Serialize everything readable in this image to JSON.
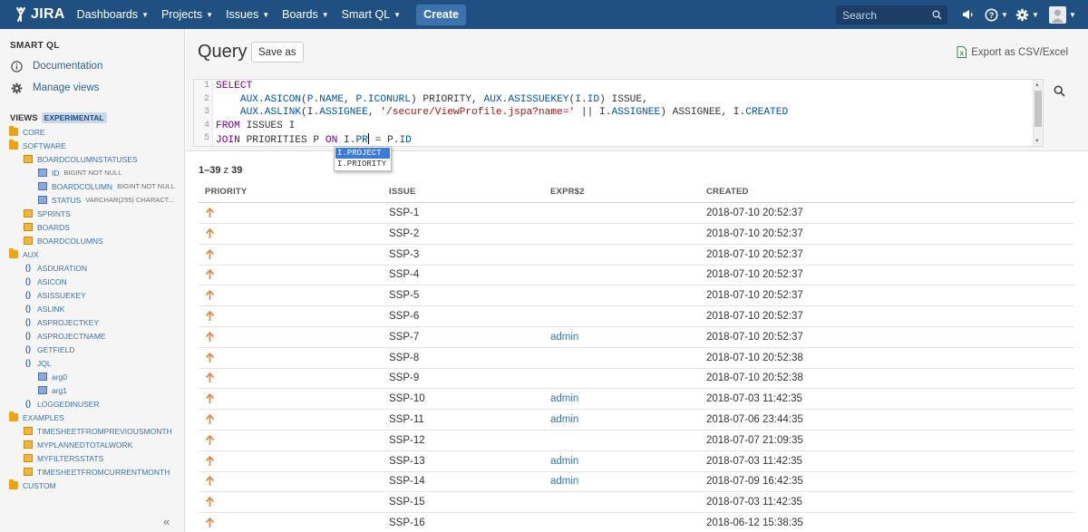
{
  "topnav": {
    "logo_text": "JIRA",
    "menus": [
      {
        "label": "Dashboards"
      },
      {
        "label": "Projects"
      },
      {
        "label": "Issues"
      },
      {
        "label": "Boards"
      },
      {
        "label": "Smart QL"
      }
    ],
    "create_label": "Create",
    "search_placeholder": "Search"
  },
  "sidebar": {
    "title": "SMART QL",
    "links": [
      {
        "label": "Documentation",
        "icon": "info-icon"
      },
      {
        "label": "Manage views",
        "icon": "gear-icon"
      }
    ],
    "views_title": "VIEWS",
    "views_badge": "EXPERIMENTAL",
    "tree": [
      {
        "label": "CORE",
        "type": "folder",
        "level": 0
      },
      {
        "label": "SOFTWARE",
        "type": "folder",
        "level": 0
      },
      {
        "label": "BOARDCOLUMNSTATUSES",
        "type": "table",
        "level": 1
      },
      {
        "label": "ID",
        "type": "column",
        "level": 2,
        "coltype": "BIGINT NOT NULL"
      },
      {
        "label": "BOARDCOLUMN",
        "type": "column",
        "level": 2,
        "coltype": "BIGINT NOT NULL"
      },
      {
        "label": "STATUS",
        "type": "column",
        "level": 2,
        "coltype": "VARCHAR(255) CHARACT..."
      },
      {
        "label": "SPRINTS",
        "type": "table",
        "level": 1
      },
      {
        "label": "BOARDS",
        "type": "table",
        "level": 1
      },
      {
        "label": "BOARDCOLUMNS",
        "type": "table",
        "level": 1
      },
      {
        "label": "AUX",
        "type": "folder",
        "level": 0
      },
      {
        "label": "ASDURATION",
        "type": "function",
        "level": 1
      },
      {
        "label": "ASICON",
        "type": "function",
        "level": 1
      },
      {
        "label": "ASISSUEKEY",
        "type": "function",
        "level": 1
      },
      {
        "label": "ASLINK",
        "type": "function",
        "level": 1
      },
      {
        "label": "ASPROJECTKEY",
        "type": "function",
        "level": 1
      },
      {
        "label": "ASPROJECTNAME",
        "type": "function",
        "level": 1
      },
      {
        "label": "GETFIELD",
        "type": "function",
        "level": 1
      },
      {
        "label": "JQL",
        "type": "function",
        "level": 1
      },
      {
        "label": "arg0",
        "type": "column",
        "level": 2,
        "coltype": ""
      },
      {
        "label": "arg1",
        "type": "column",
        "level": 2,
        "coltype": ""
      },
      {
        "label": "LOGGEDINUSER",
        "type": "function",
        "level": 1
      },
      {
        "label": "EXAMPLES",
        "type": "folder",
        "level": 0
      },
      {
        "label": "TIMESHEETFROMPREVIOUSMONTH",
        "type": "table",
        "level": 1
      },
      {
        "label": "MYPLANNEDTOTALWORK",
        "type": "table",
        "level": 1
      },
      {
        "label": "MYFILTERSSTATS",
        "type": "table",
        "level": 1
      },
      {
        "label": "TIMESHEETFROMCURRENTMONTH",
        "type": "table",
        "level": 1
      },
      {
        "label": "CUSTOM",
        "type": "folder",
        "level": 0
      }
    ],
    "collapse_label": "«"
  },
  "main": {
    "title": "Query",
    "save_as_label": "Save as",
    "export_label": "Export as CSV/Excel",
    "editor": {
      "line_numbers": [
        "1",
        "2",
        "3",
        "4",
        "5"
      ],
      "lines": [
        [
          {
            "t": "SELECT",
            "c": "kw"
          }
        ],
        [
          {
            "t": "    "
          },
          {
            "t": "AUX",
            "c": "vr"
          },
          {
            "t": "."
          },
          {
            "t": "ASICON",
            "c": "vr"
          },
          {
            "t": "("
          },
          {
            "t": "P",
            "c": "vr"
          },
          {
            "t": "."
          },
          {
            "t": "NAME",
            "c": "vr"
          },
          {
            "t": ", "
          },
          {
            "t": "P",
            "c": "vr"
          },
          {
            "t": "."
          },
          {
            "t": "ICONURL",
            "c": "vr"
          },
          {
            "t": ") PRIORITY, "
          },
          {
            "t": "AUX",
            "c": "vr"
          },
          {
            "t": "."
          },
          {
            "t": "ASISSUEKEY",
            "c": "vr"
          },
          {
            "t": "("
          },
          {
            "t": "I",
            "c": "vr"
          },
          {
            "t": "."
          },
          {
            "t": "ID",
            "c": "vr"
          },
          {
            "t": ") ISSUE,"
          }
        ],
        [
          {
            "t": "    "
          },
          {
            "t": "AUX",
            "c": "vr"
          },
          {
            "t": "."
          },
          {
            "t": "ASLINK",
            "c": "vr"
          },
          {
            "t": "(I."
          },
          {
            "t": "ASSIGNEE",
            "c": "vr"
          },
          {
            "t": ", "
          },
          {
            "t": "'/secure/ViewProfile.jspa?name='",
            "c": "str"
          },
          {
            "t": " || I."
          },
          {
            "t": "ASSIGNEE",
            "c": "vr"
          },
          {
            "t": ") ASSIGNEE, I."
          },
          {
            "t": "CREATED",
            "c": "vr"
          }
        ],
        [
          {
            "t": "FROM",
            "c": "kw"
          },
          {
            "t": " ISSUES I"
          }
        ],
        [
          {
            "t": "JOIN",
            "c": "kw"
          },
          {
            "t": " PRIORITIES P "
          },
          {
            "t": "ON",
            "c": "kw"
          },
          {
            "t": " I."
          },
          {
            "t": "PR",
            "c": "vr"
          },
          {
            "t": "|CURSOR|"
          },
          {
            "t": " = P."
          },
          {
            "t": "ID",
            "c": "vr"
          }
        ]
      ],
      "autocomplete": [
        "I.PROJECT",
        "I.PRIORITY"
      ]
    },
    "result_count": {
      "range": "1–39",
      "of": "z",
      "total": "39"
    },
    "columns": [
      "PRIORITY",
      "ISSUE",
      "EXPR$2",
      "CREATED"
    ],
    "rows": [
      {
        "issue": "SSP-1",
        "assignee": "",
        "created": "2018-07-10 20:52:37"
      },
      {
        "issue": "SSP-2",
        "assignee": "",
        "created": "2018-07-10 20:52:37"
      },
      {
        "issue": "SSP-3",
        "assignee": "",
        "created": "2018-07-10 20:52:37"
      },
      {
        "issue": "SSP-4",
        "assignee": "",
        "created": "2018-07-10 20:52:37"
      },
      {
        "issue": "SSP-5",
        "assignee": "",
        "created": "2018-07-10 20:52:37"
      },
      {
        "issue": "SSP-6",
        "assignee": "",
        "created": "2018-07-10 20:52:37"
      },
      {
        "issue": "SSP-7",
        "assignee": "admin",
        "created": "2018-07-10 20:52:37"
      },
      {
        "issue": "SSP-8",
        "assignee": "",
        "created": "2018-07-10 20:52:38"
      },
      {
        "issue": "SSP-9",
        "assignee": "",
        "created": "2018-07-10 20:52:38"
      },
      {
        "issue": "SSP-10",
        "assignee": "admin",
        "created": "2018-07-03 11:42:35"
      },
      {
        "issue": "SSP-11",
        "assignee": "admin",
        "created": "2018-07-06 23:44:35"
      },
      {
        "issue": "SSP-12",
        "assignee": "",
        "created": "2018-07-07 21:09:35"
      },
      {
        "issue": "SSP-13",
        "assignee": "admin",
        "created": "2018-07-03 11:42:35"
      },
      {
        "issue": "SSP-14",
        "assignee": "admin",
        "created": "2018-07-09 16:42:35"
      },
      {
        "issue": "SSP-15",
        "assignee": "",
        "created": "2018-07-03 11:42:35"
      },
      {
        "issue": "SSP-16",
        "assignee": "",
        "created": "2018-06-12 15:38:35"
      }
    ],
    "priority_icon": "arrow-up-icon",
    "priority_color": "#e8833a"
  }
}
